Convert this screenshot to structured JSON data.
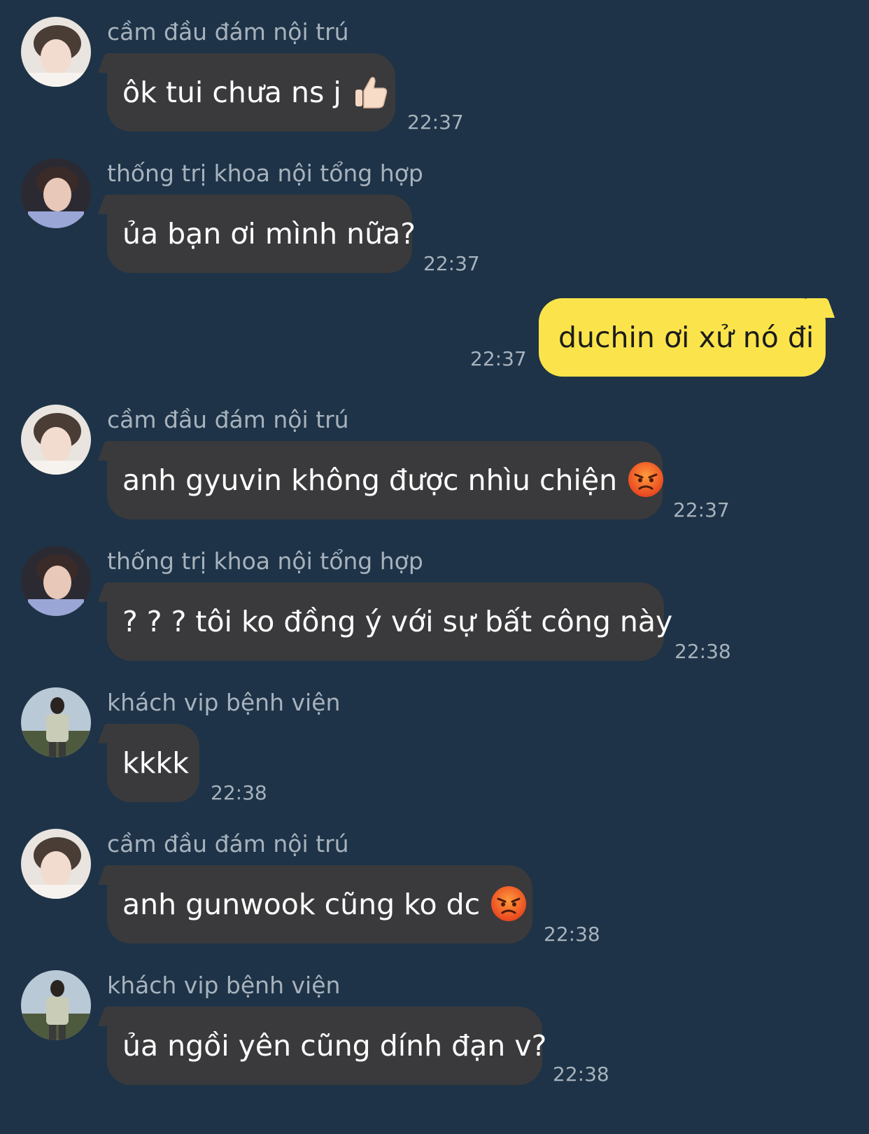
{
  "messages": [
    {
      "sender": "cầm đầu đám nội trú",
      "text": "ôk tui chưa ns j",
      "emoji": "thumbs-up-emoji",
      "time": "22:37"
    },
    {
      "sender": "thống trị khoa nội tổng hợp",
      "text": "ủa bạn ơi mình nữa?",
      "time": "22:37"
    },
    {
      "text": "duchin ơi xử nó đi",
      "time": "22:37",
      "outgoing": true
    },
    {
      "sender": "cầm đầu đám nội trú",
      "text": "anh gyuvin không được nhìu chiện",
      "emoji": "angry-face-emoji",
      "time": "22:37"
    },
    {
      "sender": "thống trị khoa nội tổng hợp",
      "text": "? ? ? tôi ko đồng ý với sự bất công này",
      "time": "22:38"
    },
    {
      "sender": "khách vip bệnh viện",
      "text": "kkkk",
      "time": "22:38"
    },
    {
      "sender": "cầm đầu đám nội trú",
      "text": "anh gunwook cũng ko dc",
      "emoji": "angry-face-emoji",
      "time": "22:38"
    },
    {
      "sender": "khách vip bệnh viện",
      "text": "ủa ngồi yên cũng dính đạn v?",
      "time": "22:38"
    }
  ],
  "colors": {
    "background": "#1e3347",
    "incoming_bubble": "#3a3a3c",
    "outgoing_bubble": "#fbe44b",
    "meta_text": "#a7b2bd"
  }
}
